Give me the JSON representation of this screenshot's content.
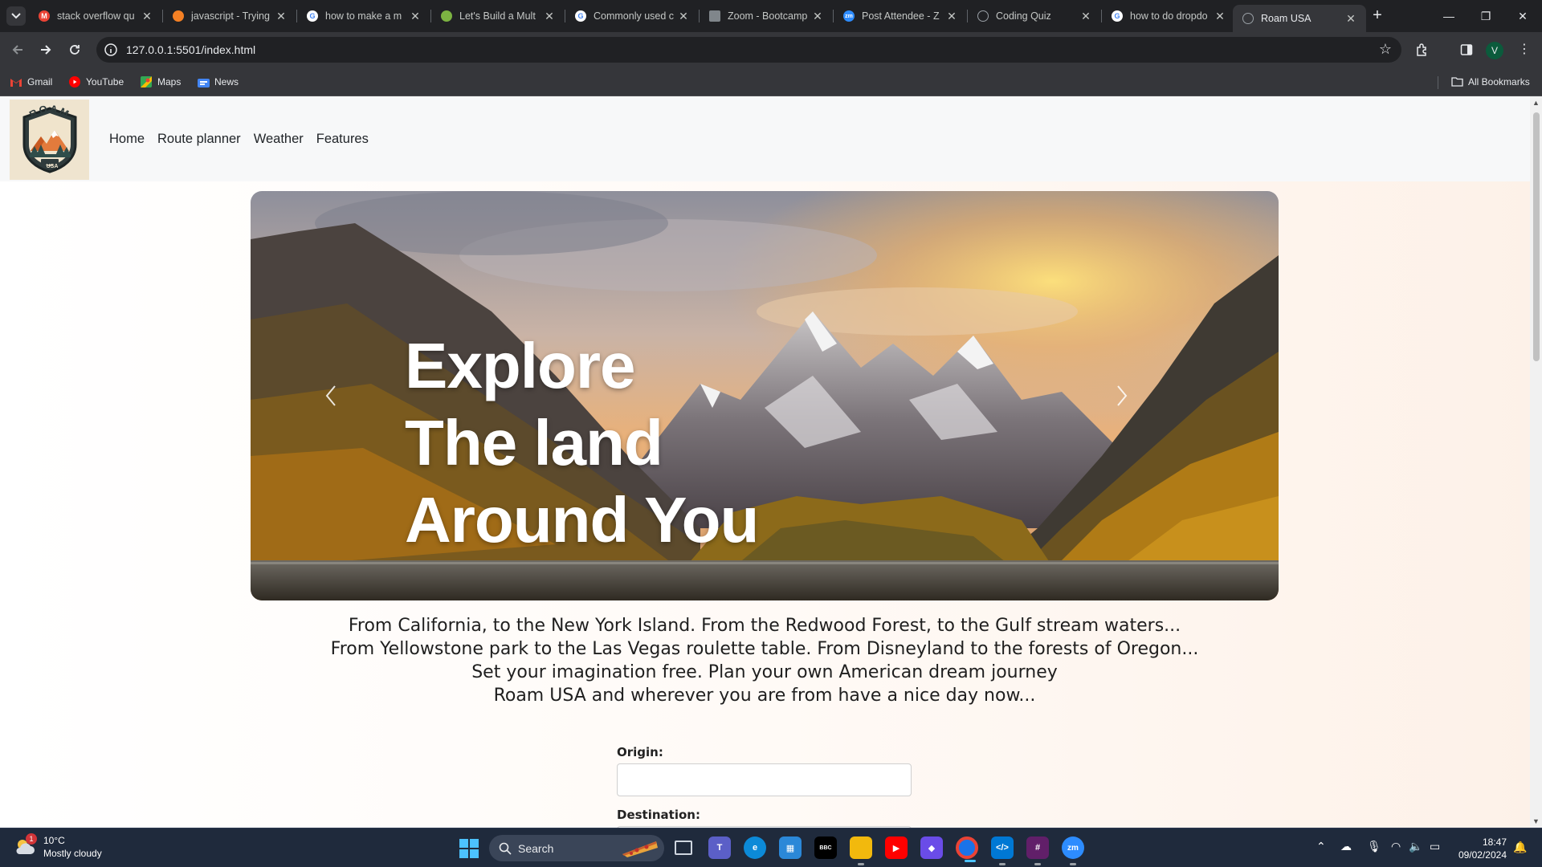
{
  "browser": {
    "tabs": [
      {
        "title": "stack overflow qu",
        "favicon": "gmail-icon",
        "color": "#ea4335"
      },
      {
        "title": "javascript - Trying",
        "favicon": "stackoverflow-icon",
        "color": "#f48024"
      },
      {
        "title": "how to make a m",
        "favicon": "google-icon",
        "color": "#4285f4"
      },
      {
        "title": "Let's Build a Mult",
        "favicon": "leaf-icon",
        "color": "#7cb342"
      },
      {
        "title": "Commonly used c",
        "favicon": "google-icon",
        "color": "#4285f4"
      },
      {
        "title": "Zoom - Bootcamp",
        "favicon": "zoom-doc-icon",
        "color": "#80868b"
      },
      {
        "title": "Post Attendee - Z",
        "favicon": "zoom-icon",
        "color": "#2d8cff"
      },
      {
        "title": "Coding Quiz",
        "favicon": "globe-icon",
        "color": "#9aa0a6"
      },
      {
        "title": "how to do dropdo",
        "favicon": "google-icon",
        "color": "#4285f4"
      },
      {
        "title": "Roam USA",
        "favicon": "globe-icon",
        "color": "#9aa0a6",
        "active": true
      }
    ],
    "url": "127.0.0.1:5501/index.html",
    "profile_initial": "V",
    "bookmarks": [
      {
        "label": "Gmail",
        "icon": "gmail-icon"
      },
      {
        "label": "YouTube",
        "icon": "youtube-icon"
      },
      {
        "label": "Maps",
        "icon": "maps-icon"
      },
      {
        "label": "News",
        "icon": "news-icon"
      }
    ],
    "all_bookmarks_label": "All Bookmarks"
  },
  "site": {
    "logo": {
      "top_text": "ROAM",
      "bottom_text": "USA"
    },
    "nav": [
      "Home",
      "Route planner",
      "Weather",
      "Features"
    ],
    "hero": {
      "title_lines": [
        "Explore",
        "The land",
        "Around You"
      ],
      "prev_icon": "chevron-left-icon",
      "next_icon": "chevron-right-icon"
    },
    "intro_lines": [
      "From California, to the New York Island. From the Redwood Forest, to the Gulf stream waters...",
      "From Yellowstone park to the Las Vegas roulette table. From Disneyland to the forests of Oregon...",
      "Set your imagination free. Plan your own American dream journey",
      "Roam USA and wherever you are from have a nice day now..."
    ],
    "form": {
      "origin_label": "Origin:",
      "origin_value": "",
      "destination_label": "Destination:",
      "destination_value": ""
    }
  },
  "taskbar": {
    "weather": {
      "temp": "10°C",
      "condition": "Mostly cloudy",
      "badge": "1"
    },
    "search_placeholder": "Search",
    "apps": [
      {
        "name": "task-view",
        "color": "#3a4558"
      },
      {
        "name": "teams",
        "color": "#5b5fc7"
      },
      {
        "name": "edge",
        "color": "#0c8ad8"
      },
      {
        "name": "store",
        "color": "#2b88d8"
      },
      {
        "name": "bbc-iplayer",
        "color": "#000000"
      },
      {
        "name": "file-explorer",
        "color": "#f2b90d"
      },
      {
        "name": "youtube",
        "color": "#ff0000"
      },
      {
        "name": "clipchamp",
        "color": "#6a4ce8"
      },
      {
        "name": "chrome",
        "color": "#1a73e8"
      },
      {
        "name": "vscode",
        "color": "#0078d4"
      },
      {
        "name": "slack",
        "color": "#611f69"
      },
      {
        "name": "zoom",
        "color": "#2d8cff"
      }
    ],
    "time": "18:47",
    "date": "09/02/2024"
  }
}
